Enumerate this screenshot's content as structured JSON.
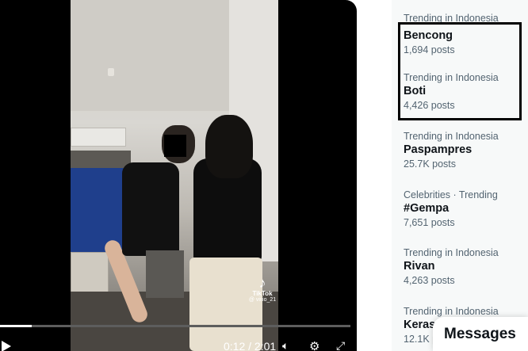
{
  "video": {
    "progress": 0.09,
    "time": "0:12 / 2:01",
    "watermark_name": "TikTok",
    "watermark_handle": "@ viiiio_21"
  },
  "trends": [
    {
      "meta": "Trending in Indonesia",
      "name": "Bencong",
      "posts": "1,694 posts"
    },
    {
      "meta": "Trending in Indonesia",
      "name": "Boti",
      "posts": "4,426 posts"
    },
    {
      "meta": "Trending in Indonesia",
      "name": "Paspampres",
      "posts": "25.7K posts"
    },
    {
      "meta": "Celebrities · Trending",
      "name": "#Gempa",
      "posts": "7,651 posts"
    },
    {
      "meta": "Trending in Indonesia",
      "name": "Rivan",
      "posts": "4,263 posts"
    },
    {
      "meta": "Trending in Indonesia",
      "name": "Keras",
      "posts": "12.1K posts"
    }
  ],
  "top_partial_meta": "Trending in Indonesia",
  "messages_label": "Messages",
  "icons": {
    "play": "play-icon",
    "volume": "volume-icon",
    "settings": "gear-icon",
    "fullscreen": "fullscreen-icon",
    "tiktok": "tiktok-icon"
  },
  "colors": {
    "highlight_border": "#000000",
    "secondary_text": "#536471",
    "primary_text": "#0f1419"
  }
}
